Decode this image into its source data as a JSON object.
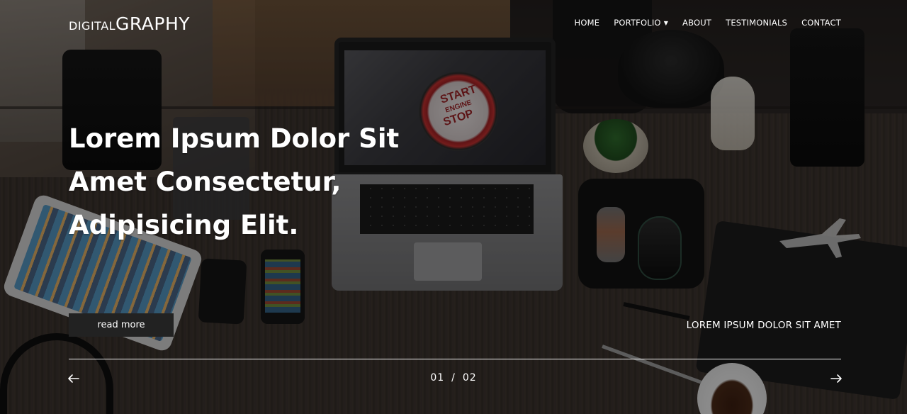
{
  "header": {
    "logo_small": "DIGITAL",
    "logo_big": "GRAPHY",
    "nav": [
      {
        "label": "HOME"
      },
      {
        "label": "PORTFOLIO",
        "has_dropdown": true
      },
      {
        "label": "ABOUT"
      },
      {
        "label": "TESTIMONIALS"
      },
      {
        "label": "CONTACT"
      }
    ]
  },
  "background_screen_text": {
    "line1": "START",
    "line2": "ENGINE",
    "line3": "STOP"
  },
  "hero": {
    "headline_line1": "Lorem Ipsum Dolor Sit",
    "headline_line2": "Amet Consectetur,",
    "headline_line3": "Adipisicing Elit.",
    "cta_label": "read more",
    "caption": "LOREM IPSUM DOLOR SIT AMET"
  },
  "slider": {
    "current": "01",
    "separator": "/",
    "total": "02",
    "prev_icon": "arrow-left-icon",
    "next_icon": "arrow-right-icon"
  },
  "colors": {
    "text": "#ffffff",
    "button_bg": "#222222",
    "overlay": "rgba(0,0,0,0.40)"
  }
}
